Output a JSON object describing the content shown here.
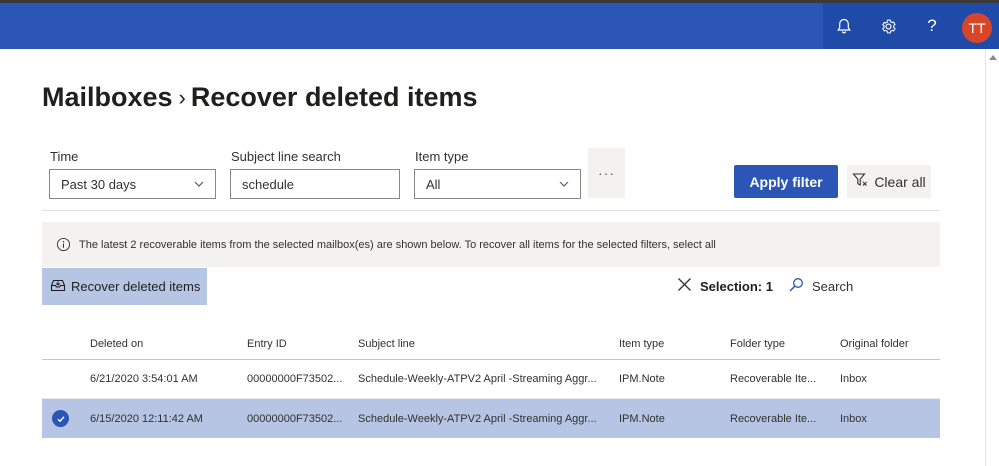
{
  "header": {
    "avatar_initials": "TT",
    "icons": [
      "bell-icon",
      "gear-icon",
      "help-icon"
    ]
  },
  "breadcrumb": {
    "parent": "Mailboxes",
    "separator": "›",
    "current": "Recover deleted items"
  },
  "filters": {
    "time": {
      "label": "Time",
      "value": "Past 30 days"
    },
    "subject": {
      "label": "Subject line search",
      "value": "schedule"
    },
    "item_type": {
      "label": "Item type",
      "value": "All"
    },
    "more_label": "···",
    "apply_label": "Apply filter",
    "clear_label": "Clear all"
  },
  "info": {
    "message": "The latest 2 recoverable items from the selected mailbox(es) are shown below. To recover all items for the selected filters, select all"
  },
  "toolbar": {
    "recover_label": "Recover deleted items",
    "selection_label": "Selection: 1",
    "search_label": "Search"
  },
  "table": {
    "columns": [
      "Deleted on",
      "Entry ID",
      "Subject line",
      "Item type",
      "Folder type",
      "Original folder"
    ],
    "rows": [
      {
        "deleted_on": "6/21/2020 3:54:01 AM",
        "entry_id": "00000000F73502...",
        "subject": "Schedule-Weekly-ATPV2 April -Streaming Aggr...",
        "item_type": "IPM.Note",
        "folder_type": "Recoverable Ite...",
        "original_folder": "Inbox",
        "selected": false
      },
      {
        "deleted_on": "6/15/2020 12:11:42 AM",
        "entry_id": "00000000F73502...",
        "subject": "Schedule-Weekly-ATPV2 April -Streaming Aggr...",
        "item_type": "IPM.Note",
        "folder_type": "Recoverable Ite...",
        "original_folder": "Inbox",
        "selected": true
      }
    ]
  },
  "colors": {
    "brand": "#2b56b6",
    "selected_row": "#b5c5e3",
    "avatar": "#d8462a"
  }
}
